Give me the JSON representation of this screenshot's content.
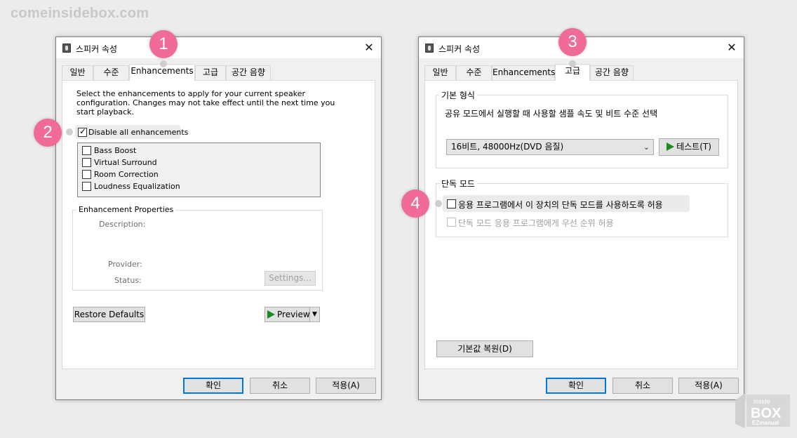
{
  "watermark": "comeinsidebox.com",
  "left_dialog": {
    "title": "스피커 속성",
    "close": "✕",
    "tabs": [
      "일반",
      "수준",
      "Enhancements",
      "고급",
      "공간 음향"
    ],
    "active_tab": "Enhancements",
    "description": "Select the enhancements to apply for your current speaker configuration. Changes may not take effect until the next time you start playback.",
    "disable_all": {
      "label": "Disable all enhancements",
      "checked": true
    },
    "enhancements": [
      {
        "label": "Bass Boost",
        "checked": false
      },
      {
        "label": "Virtual Surround",
        "checked": false
      },
      {
        "label": "Room Correction",
        "checked": false
      },
      {
        "label": "Loudness Equalization",
        "checked": false
      }
    ],
    "properties_group": "Enhancement Properties",
    "description_label": "Description:",
    "provider_label": "Provider:",
    "status_label": "Status:",
    "settings_button": "Settings...",
    "restore_button": "Restore Defaults",
    "preview_button": "Preview",
    "ok_button": "확인",
    "cancel_button": "취소",
    "apply_button": "적용(A)"
  },
  "right_dialog": {
    "title": "스피커 속성",
    "close": "✕",
    "tabs": [
      "일반",
      "수준",
      "Enhancements",
      "고급",
      "공간 음향"
    ],
    "active_tab": "고급",
    "default_format_group": "기본 형식",
    "default_format_desc": "공유 모드에서 실행할 때 사용할 샘플 속도 및 비트 수준 선택",
    "format_value": "16비트, 48000Hz(DVD 음질)",
    "test_button": "테스트(T)",
    "exclusive_group": "단독 모드",
    "allow_exclusive": {
      "label": "응용 프로그램에서 이 장치의 단독 모드를 사용하도록 허용",
      "checked": false
    },
    "give_priority": {
      "label": "단독 모드 응용 프로그램에게 우선 순위 허용",
      "checked": false
    },
    "restore_button": "기본값 복원(D)",
    "ok_button": "확인",
    "cancel_button": "취소",
    "apply_button": "적용(A)"
  },
  "markers": [
    "1",
    "2",
    "3",
    "4"
  ],
  "logo": {
    "line1": "inside",
    "line2": "BOX",
    "line3": "EZmanual"
  }
}
